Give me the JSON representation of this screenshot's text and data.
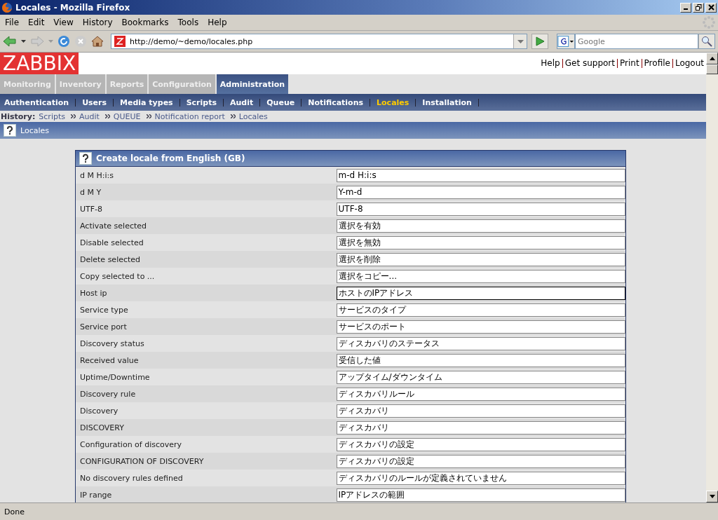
{
  "window": {
    "title": "Locales - Mozilla Firefox"
  },
  "menu": [
    "File",
    "Edit",
    "View",
    "History",
    "Bookmarks",
    "Tools",
    "Help"
  ],
  "address_bar": {
    "value": "http://demo/~demo/locales.php"
  },
  "search": {
    "placeholder": "Google"
  },
  "header": {
    "logo": "ZABBIX",
    "links": [
      "Help",
      "Get support",
      "Print",
      "Profile",
      "Logout"
    ]
  },
  "main_tabs": [
    {
      "label": "Monitoring",
      "selected": false
    },
    {
      "label": "Inventory",
      "selected": false
    },
    {
      "label": "Reports",
      "selected": false
    },
    {
      "label": "Configuration",
      "selected": false
    },
    {
      "label": "Administration",
      "selected": true
    }
  ],
  "sub_tabs": [
    {
      "label": "Authentication",
      "selected": false
    },
    {
      "label": "Users",
      "selected": false
    },
    {
      "label": "Media types",
      "selected": false
    },
    {
      "label": "Scripts",
      "selected": false
    },
    {
      "label": "Audit",
      "selected": false
    },
    {
      "label": "Queue",
      "selected": false
    },
    {
      "label": "Notifications",
      "selected": false
    },
    {
      "label": "Locales",
      "selected": true
    },
    {
      "label": "Installation",
      "selected": false
    }
  ],
  "history": {
    "label": "History:",
    "items": [
      "Scripts",
      "Audit",
      "QUEUE",
      "Notification report",
      "Locales"
    ]
  },
  "page_title": "Locales",
  "form": {
    "title": "Create locale from English (GB)",
    "rows": [
      {
        "label": "d M H:i:s",
        "value": "m-d H:i:s",
        "focused": false
      },
      {
        "label": "d M Y",
        "value": "Y-m-d",
        "focused": false
      },
      {
        "label": "UTF-8",
        "value": "UTF-8",
        "focused": false
      },
      {
        "label": "Activate selected",
        "value": "選択を有効",
        "focused": false
      },
      {
        "label": "Disable selected",
        "value": "選択を無効",
        "focused": false
      },
      {
        "label": "Delete selected",
        "value": "選択を削除",
        "focused": false
      },
      {
        "label": "Copy selected to ...",
        "value": "選択をコピー...",
        "focused": false
      },
      {
        "label": "Host ip",
        "value": "ホストのIPアドレス",
        "focused": true
      },
      {
        "label": "Service type",
        "value": "サービスのタイプ",
        "focused": false
      },
      {
        "label": "Service port",
        "value": "サービスのポート",
        "focused": false
      },
      {
        "label": "Discovery status",
        "value": "ディスカバリのステータス",
        "focused": false
      },
      {
        "label": "Received value",
        "value": "受信した値",
        "focused": false
      },
      {
        "label": "Uptime/Downtime",
        "value": "アップタイム/ダウンタイム",
        "focused": false
      },
      {
        "label": "Discovery rule",
        "value": "ディスカバリルール",
        "focused": false
      },
      {
        "label": "Discovery",
        "value": "ディスカバリ",
        "focused": false
      },
      {
        "label": "DISCOVERY",
        "value": "ディスカバリ",
        "focused": false
      },
      {
        "label": "Configuration of discovery",
        "value": "ディスカバリの設定",
        "focused": false
      },
      {
        "label": "CONFIGURATION OF DISCOVERY",
        "value": "ディスカバリの設定",
        "focused": false
      },
      {
        "label": "No discovery rules defined",
        "value": "ディスカバリのルールが定義されていません",
        "focused": false
      },
      {
        "label": "IP range",
        "value": "IPアドレスの範囲",
        "focused": false
      }
    ]
  },
  "status_bar": {
    "text": "Done"
  }
}
